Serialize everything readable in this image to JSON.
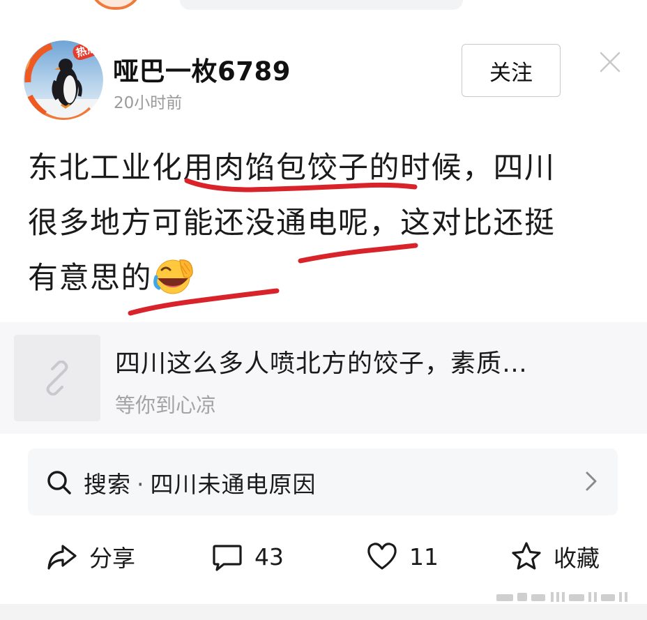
{
  "post": {
    "author": "哑巴一枚6789",
    "time": "20小时前",
    "avatar_badge": "热点虎",
    "follow_label": "关注",
    "body_lines": [
      "东北工业化用肉馅包饺子的时候，四川",
      "很多地方可能还没通电呢，这对比还挺",
      "有意思的"
    ],
    "emoji": "laughing-face-icon"
  },
  "link_card": {
    "title": "四川这么多人喷北方的饺子，素质…",
    "source": "等你到心凉",
    "thumb_icon": "link-icon"
  },
  "search": {
    "label": "搜索",
    "separator": "·",
    "query": "四川未通电原因"
  },
  "actions": {
    "share_label": "分享",
    "comment_count": "43",
    "like_count": "11",
    "favorite_label": "收藏"
  },
  "colors": {
    "annotation_red": "#d8232a",
    "secondary_text": "#9a9a9a",
    "card_background": "#f7f7f9"
  }
}
